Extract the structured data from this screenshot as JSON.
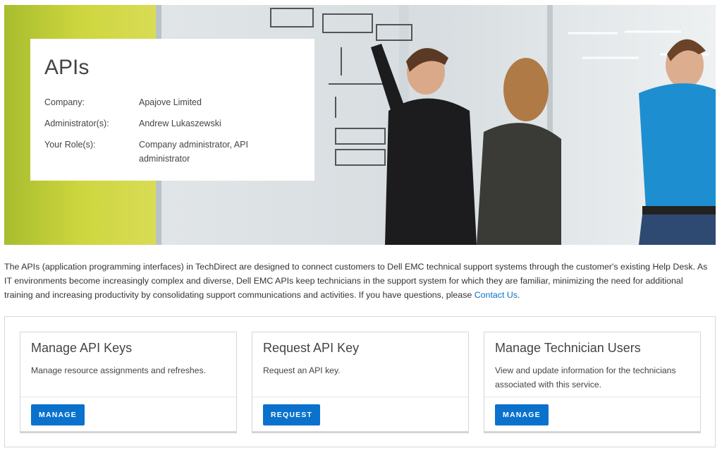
{
  "hero": {
    "title": "APIs",
    "rows": [
      {
        "label": "Company:",
        "value": "Apajove Limited"
      },
      {
        "label": "Administrator(s):",
        "value": "Andrew Lukaszewski"
      },
      {
        "label": "Your Role(s):",
        "value": "Company administrator, API administrator"
      }
    ]
  },
  "intro": {
    "text": "The APIs (application programming interfaces) in TechDirect are designed to connect customers to Dell EMC technical support systems through the customer's existing Help Desk. As IT environments become increasingly complex and diverse, Dell EMC APIs keep technicians in the support system for which they are familiar, minimizing the need for additional training and increasing productivity by consolidating support communications and activities. If you have questions, please ",
    "link": "Contact Us",
    "end": "."
  },
  "tiles": [
    {
      "title": "Manage API Keys",
      "desc": "Manage resource assignments and refreshes.",
      "button": "MANAGE"
    },
    {
      "title": "Request API Key",
      "desc": "Request an API key.",
      "button": "REQUEST"
    },
    {
      "title": "Manage Technician Users",
      "desc": "View and update information for the technicians associated with this service.",
      "button": "MANAGE"
    }
  ],
  "colors": {
    "accent": "#0a72cc",
    "link": "#0a6ec8",
    "lime": "#c8d43a"
  }
}
